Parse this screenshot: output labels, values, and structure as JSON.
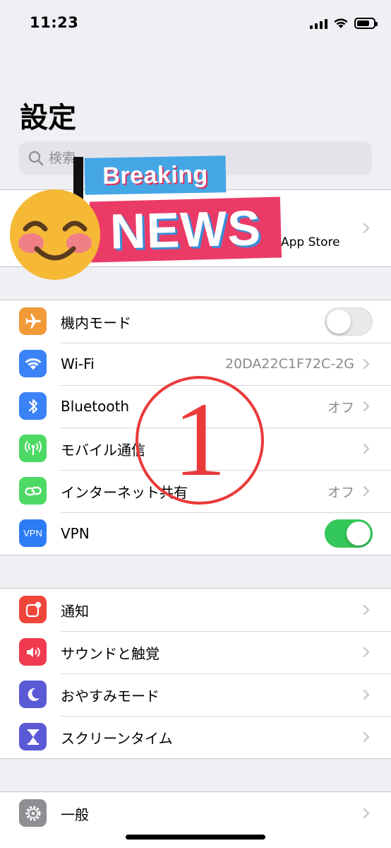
{
  "status_bar": {
    "time": "11:23"
  },
  "page": {
    "title": "設定"
  },
  "search": {
    "placeholder": "検索"
  },
  "profile": {
    "subtitle": "App Store"
  },
  "stickers": {
    "breaking": "Breaking",
    "news": "NEWS",
    "annotation_number": "1"
  },
  "network_group": [
    {
      "label": "機内モード",
      "icon": "airplane-icon",
      "color": "#f19a37",
      "toggle": false
    },
    {
      "label": "Wi-Fi",
      "icon": "wifi-icon",
      "color": "#3b82f6",
      "value": "20DA22C1F72C-2G"
    },
    {
      "label": "Bluetooth",
      "icon": "bluetooth-icon",
      "color": "#3b82f6",
      "value": "オフ"
    },
    {
      "label": "モバイル通信",
      "icon": "antenna-icon",
      "color": "#4cd964"
    },
    {
      "label": "インターネット共有",
      "icon": "hotspot-icon",
      "color": "#4cd964",
      "value": "オフ"
    },
    {
      "label": "VPN",
      "icon": "vpn-icon",
      "color": "#2d7cf6",
      "icon_text": "VPN",
      "toggle": true
    }
  ],
  "notification_group": [
    {
      "label": "通知",
      "icon": "notification-icon",
      "color": "#f0453a"
    },
    {
      "label": "サウンドと触覚",
      "icon": "speaker-icon",
      "color": "#f03a4f"
    },
    {
      "label": "おやすみモード",
      "icon": "moon-icon",
      "color": "#5a5ad6"
    },
    {
      "label": "スクリーンタイム",
      "icon": "hourglass-icon",
      "color": "#5a5ad6"
    }
  ],
  "general_group": [
    {
      "label": "一般",
      "icon": "gear-icon",
      "color": "#8e8e93"
    }
  ]
}
